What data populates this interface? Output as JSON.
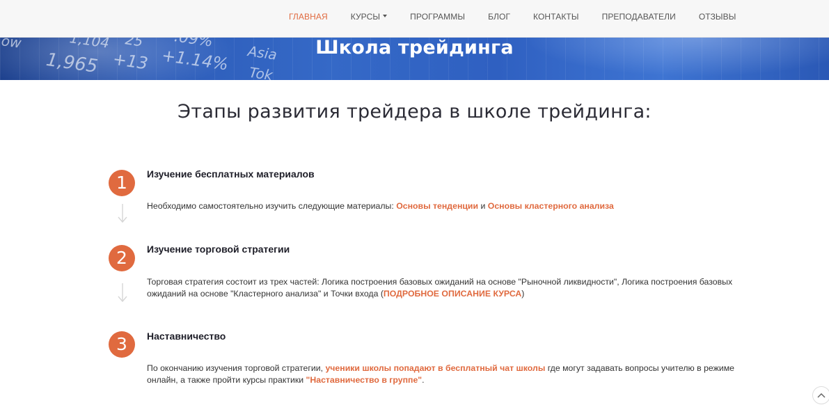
{
  "nav": {
    "items": [
      {
        "label": "ГЛАВНАЯ",
        "active": true
      },
      {
        "label": "КУРСЫ",
        "dropdown": true
      },
      {
        "label": "ПРОГРАММЫ"
      },
      {
        "label": "БЛОГ"
      },
      {
        "label": "КОНТАКТЫ"
      },
      {
        "label": "ПРЕПОДАВАТЕЛИ"
      },
      {
        "label": "ОТЗЫВЫ"
      }
    ]
  },
  "hero": {
    "title": "Школа трейдинга",
    "decor": [
      "1,965",
      "+13",
      "+1.14%",
      "Asia",
      "Tok",
      "1,104",
      "25",
      ".09%",
      "ow"
    ]
  },
  "main": {
    "title": "Этапы развития трейдера в школе трейдинга:",
    "steps": [
      {
        "number": "1",
        "title": "Изучение бесплатных материалов",
        "text_before": "Необходимо самостоятельно изучить следующие материалы: ",
        "link1": "Основы тенденции",
        "text_mid": " и ",
        "link2": "Основы кластерного анализа"
      },
      {
        "number": "2",
        "title": "Изучение торговой стратегии",
        "text_before": "Торговая стратегия состоит из трех частей: Логика построения базовых ожиданий на основе \"Рыночной ликвидности\", Логика построения базовых ожиданий на основе \"Кластерного анализа\" и Точки входа (",
        "link1": "ПОДРОБНОЕ ОПИСАНИЕ КУРСА",
        "text_after": ")"
      },
      {
        "number": "3",
        "title": "Наставничество",
        "text_before": "По окончанию изучения торговой стратегии, ",
        "link1": "ученики школы попадают в бесплатный чат школы",
        "text_mid": " где могут задавать вопросы учителю в режиме онлайн, а также пройти курсы практики ",
        "link2": "\"Наставничество в группе\"",
        "text_after": "."
      }
    ]
  },
  "colors": {
    "accent": "#e06a3f",
    "hero_blue": "#3569c7",
    "nav_bg": "#f7f7f7"
  },
  "icons": {
    "step_arrow": "arrow-down-icon",
    "scroll_top": "chevron-up-icon"
  }
}
